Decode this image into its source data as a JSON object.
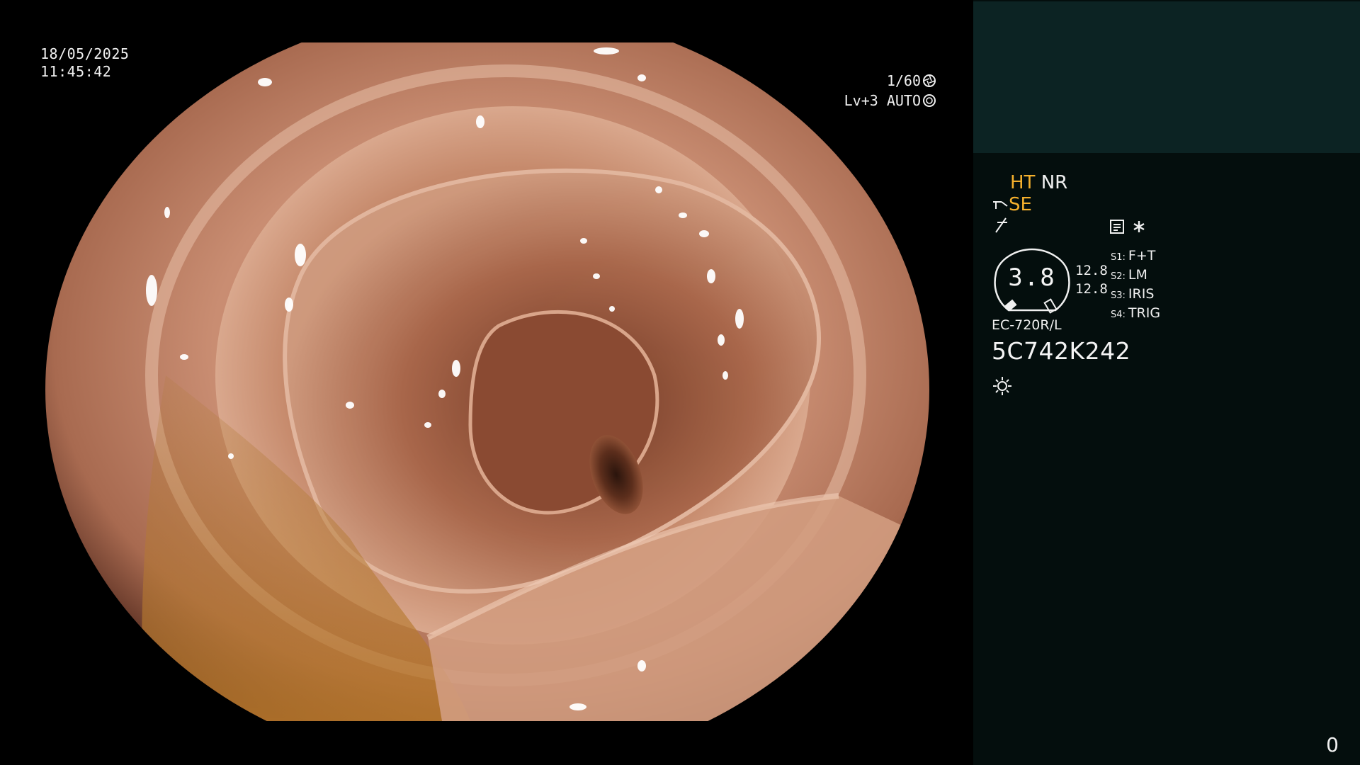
{
  "overlay": {
    "date": "18/05/2025",
    "time": "11:45:42",
    "shutter": "1/60",
    "brightness": "Lv+3 AUTO"
  },
  "panel": {
    "mode_ht": "HT",
    "mode_nr": "NR",
    "mode_se": "SE",
    "gauge_value": "3.8",
    "gauge_num_1": "12.8",
    "gauge_num_2": "12.8",
    "switches": [
      {
        "key": "S1:",
        "label": "F+T"
      },
      {
        "key": "S2:",
        "label": "LM"
      },
      {
        "key": "S3:",
        "label": "IRIS"
      },
      {
        "key": "S4:",
        "label": "TRIG"
      }
    ],
    "scope_model": "EC-720R/L",
    "scope_serial": "5C742K242",
    "page_number": "0"
  },
  "icons": {
    "shutter": "shutter-aperture-icon",
    "iris": "iris-icon",
    "scope_tip": "scope-tip-icon",
    "enhance": "structure-enhance-icon",
    "memo": "memo-icon",
    "asterisk": "asterisk-icon",
    "light": "light-source-icon"
  },
  "colors": {
    "accent_amber": "#f5b02d",
    "panel_bg": "#040e0d",
    "thumb_bg": "#0c2323",
    "osd_text": "#f0f0f0"
  }
}
